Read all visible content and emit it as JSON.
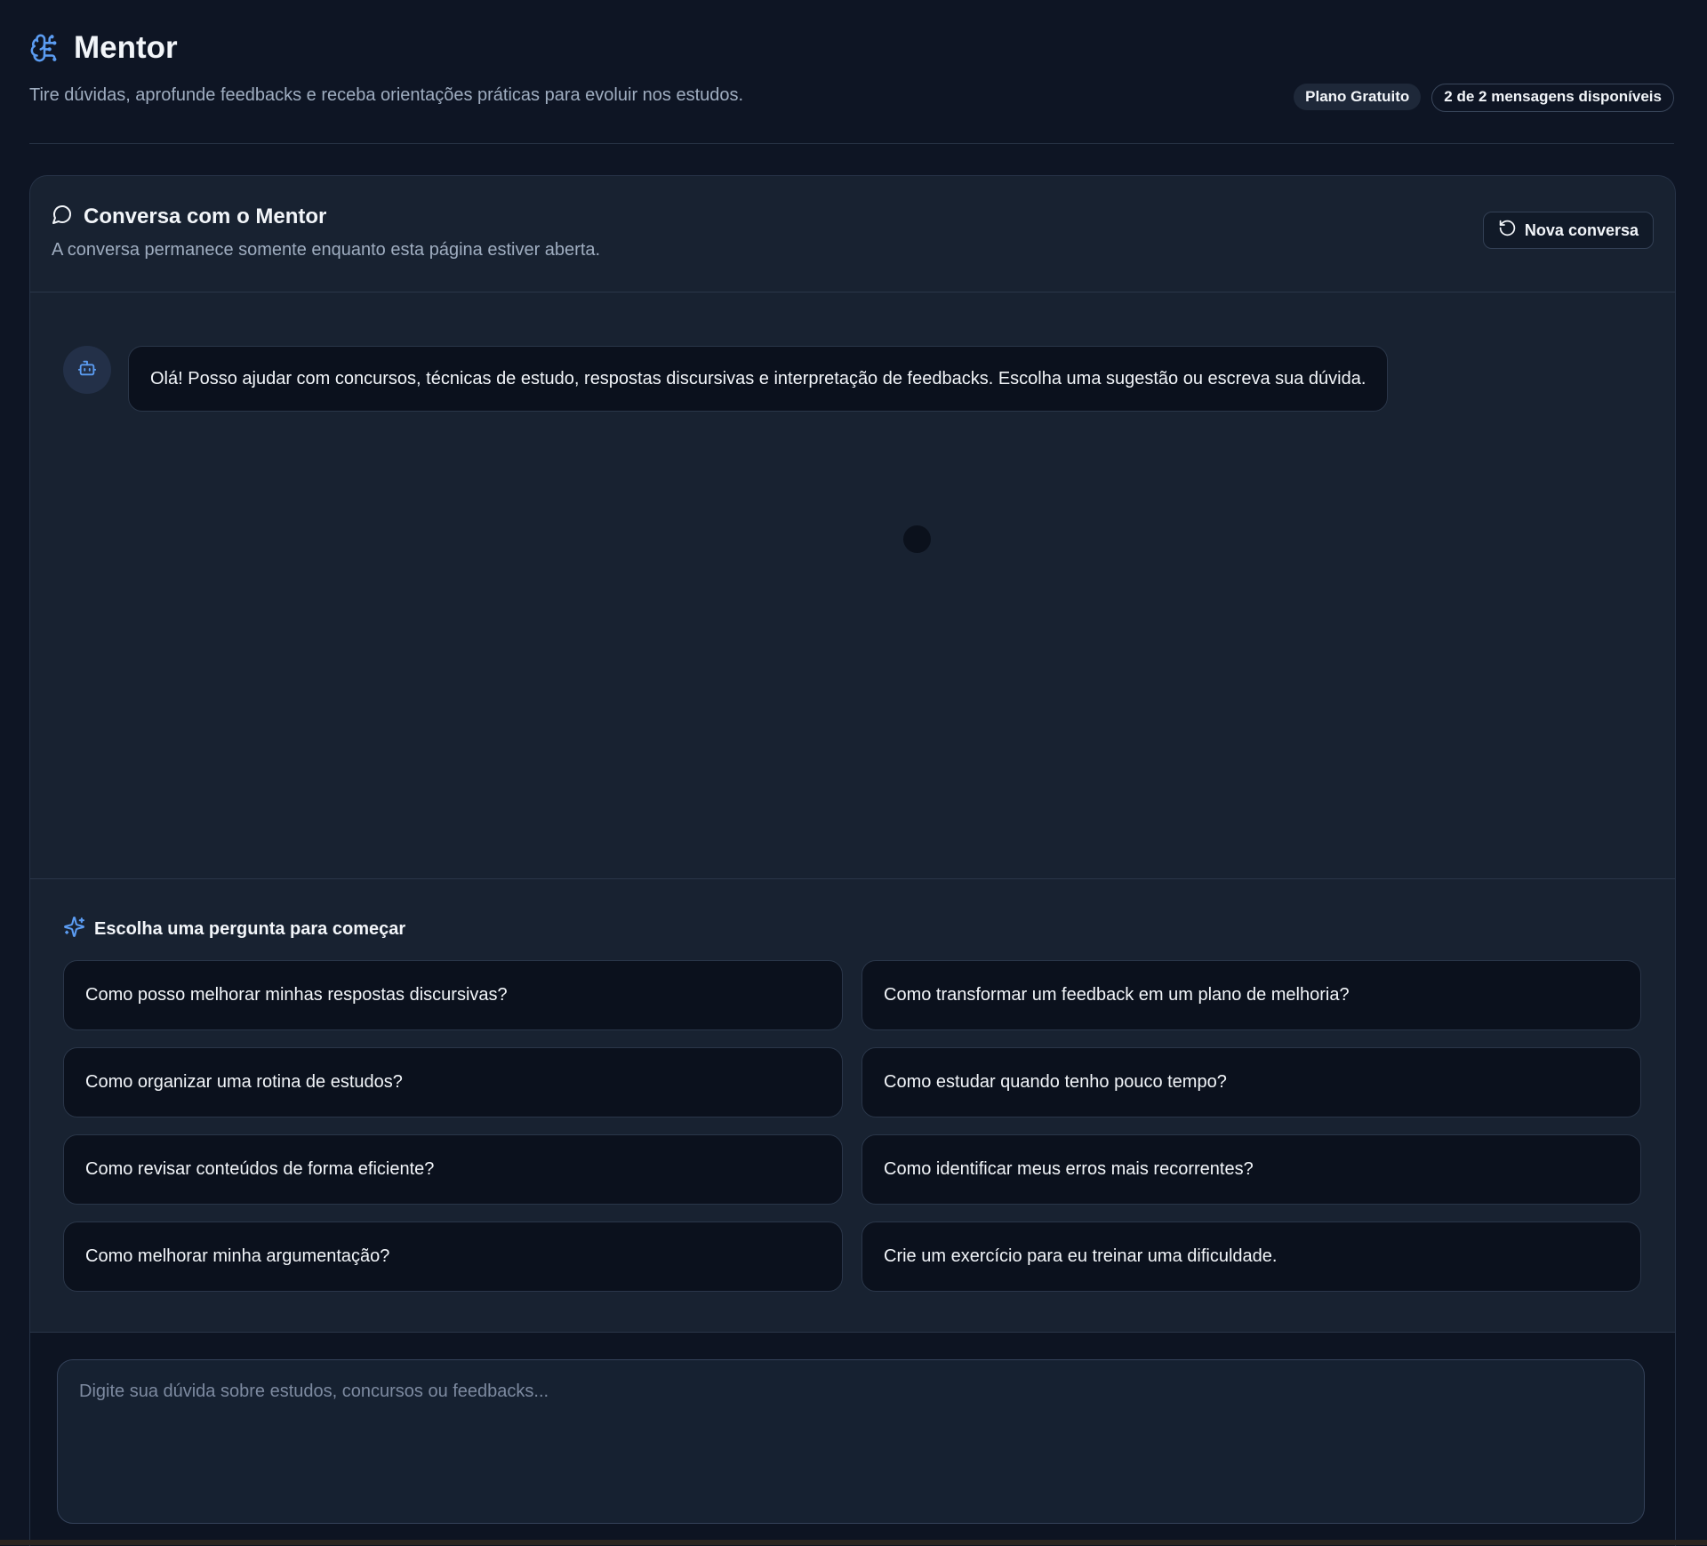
{
  "header": {
    "title": "Mentor",
    "subtitle": "Tire dúvidas, aprofunde feedbacks e receba orientações práticas para evoluir nos estudos.",
    "plan_badge": "Plano Gratuito",
    "messages_badge": "2 de 2 mensagens disponíveis",
    "icon": "brain-icon"
  },
  "chat": {
    "title": "Conversa com o Mentor",
    "subtitle": "A conversa permanece somente enquanto esta página estiver aberta.",
    "new_chat_label": "Nova conversa",
    "title_icon": "message-circle-icon",
    "new_chat_icon": "rotate-ccw-icon"
  },
  "messages": [
    {
      "role": "bot",
      "icon": "bot-icon",
      "text": "Olá! Posso ajudar com concursos, técnicas de estudo, respostas discursivas e interpretação de feedbacks. Escolha uma sugestão ou escreva sua dúvida."
    }
  ],
  "suggestions": {
    "title": "Escolha uma pergunta para começar",
    "icon": "sparkles-icon",
    "items": [
      "Como posso melhorar minhas respostas discursivas?",
      "Como transformar um feedback em um plano de melhoria?",
      "Como organizar uma rotina de estudos?",
      "Como estudar quando tenho pouco tempo?",
      "Como revisar conteúdos de forma eficiente?",
      "Como identificar meus erros mais recorrentes?",
      "Como melhorar minha argumentação?",
      "Crie um exercício para eu treinar uma dificuldade."
    ]
  },
  "input": {
    "placeholder": "Digite sua dúvida sobre estudos, concursos ou feedbacks...",
    "value": ""
  },
  "colors": {
    "background": "#0e1524",
    "card": "#182231",
    "bubble": "#0b111d",
    "accent": "#5b9cf2",
    "text": "#f2f5f9",
    "muted": "#9fadc0"
  }
}
